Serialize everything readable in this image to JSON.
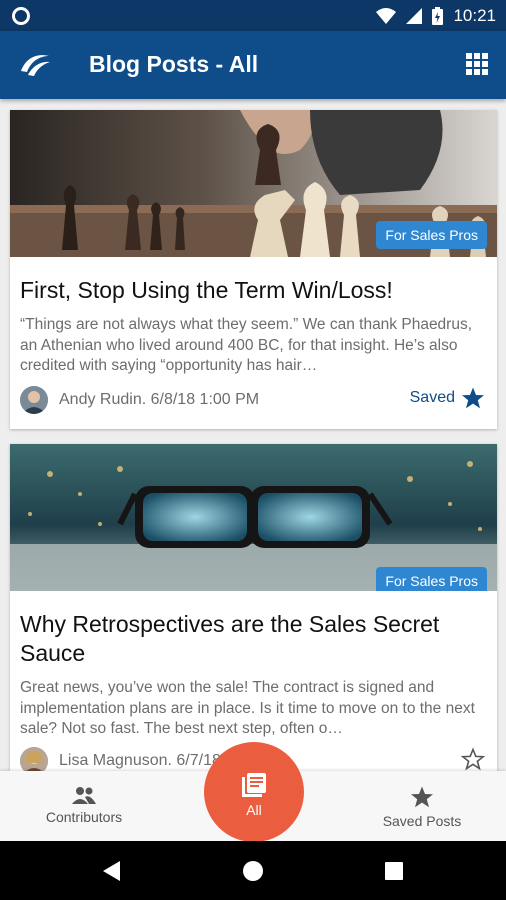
{
  "status_bar": {
    "time": "10:21"
  },
  "app_bar": {
    "title": "Blog Posts - All"
  },
  "posts": [
    {
      "badge": "For Sales Pros",
      "title": "First, Stop Using the Term Win/Loss!",
      "excerpt": "“Things are not always what they seem.” We can thank Phaedrus, an Athenian who lived around 400 BC, for that insight. He’s also credited with saying “opportunity has hair…",
      "author": "Andy Rudin. 6/8/18 1:00 PM",
      "saved_label": "Saved",
      "saved": true
    },
    {
      "badge": "For Sales Pros",
      "title": "Why Retrospectives are the Sales Secret Sauce",
      "excerpt": "Great news, you’ve won the sale! The contract is signed and implementation plans are in place. Is it time to move on to the next sale? Not so fast. The best next step, often o…",
      "author": "Lisa Magnuson. 6/7/18 1:00 PM",
      "saved": false
    }
  ],
  "bottom_nav": {
    "contributors": "Contributors",
    "all": "All",
    "saved_posts": "Saved Posts"
  }
}
